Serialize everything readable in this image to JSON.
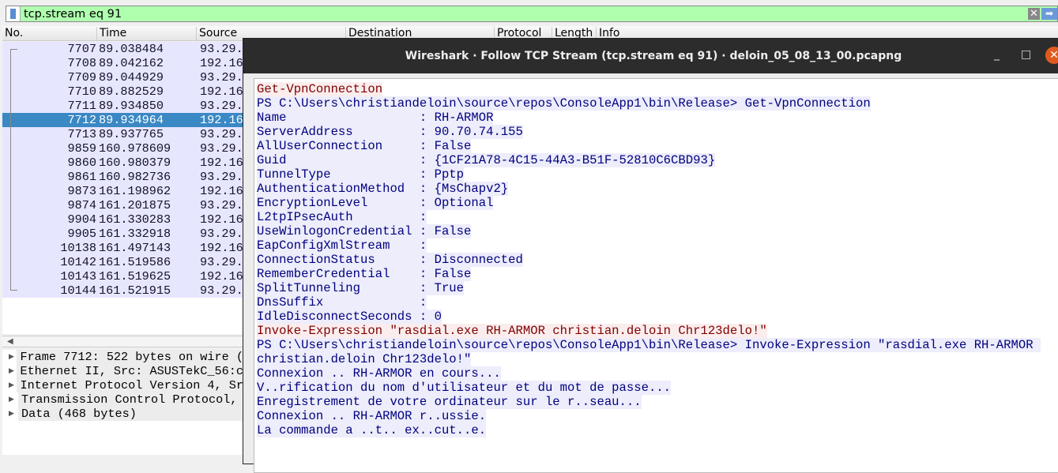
{
  "filter": {
    "value": "tcp.stream eq 91"
  },
  "columns": [
    "No.",
    "Time",
    "Source",
    "Destination",
    "Protocol",
    "Length",
    "Info"
  ],
  "packets": [
    {
      "no": "7707",
      "time": "89.038484",
      "src": "93.29."
    },
    {
      "no": "7708",
      "time": "89.042162",
      "src": "192.16"
    },
    {
      "no": "7709",
      "time": "89.044929",
      "src": "93.29."
    },
    {
      "no": "7710",
      "time": "89.882529",
      "src": "192.16"
    },
    {
      "no": "7711",
      "time": "89.934850",
      "src": "93.29."
    },
    {
      "no": "7712",
      "time": "89.934964",
      "src": "192.16",
      "selected": true
    },
    {
      "no": "7713",
      "time": "89.937765",
      "src": "93.29."
    },
    {
      "no": "9859",
      "time": "160.978609",
      "src": "93.29."
    },
    {
      "no": "9860",
      "time": "160.980379",
      "src": "192.16"
    },
    {
      "no": "9861",
      "time": "160.982736",
      "src": "93.29."
    },
    {
      "no": "9873",
      "time": "161.198962",
      "src": "192.16"
    },
    {
      "no": "9874",
      "time": "161.201875",
      "src": "93.29."
    },
    {
      "no": "9904",
      "time": "161.330283",
      "src": "192.16"
    },
    {
      "no": "9905",
      "time": "161.332918",
      "src": "93.29."
    },
    {
      "no": "10138",
      "time": "161.497143",
      "src": "192.16"
    },
    {
      "no": "10142",
      "time": "161.519586",
      "src": "93.29."
    },
    {
      "no": "10143",
      "time": "161.519625",
      "src": "192.16"
    },
    {
      "no": "10144",
      "time": "161.521915",
      "src": "93.29."
    }
  ],
  "details": [
    "Frame 7712: 522 bytes on wire (",
    "Ethernet II, Src: ASUSTekC_56:c",
    "Internet Protocol Version 4, Sr",
    "Transmission Control Protocol, ",
    "Data (468 bytes)"
  ],
  "dialog": {
    "title": "Wireshark · Follow TCP Stream (tcp.stream eq 91) · deloin_05_08_13_00.pcapng",
    "minimize": "_",
    "maximize": "□",
    "close": "✕",
    "lines": [
      {
        "t": "c",
        "text": "Get-VpnConnection"
      },
      {
        "t": "s",
        "text": "PS C:\\Users\\christiandeloin\\source\\repos\\ConsoleApp1\\bin\\Release> Get-VpnConnection"
      },
      {
        "t": "s",
        "text": "Name                  : RH-ARMOR"
      },
      {
        "t": "s",
        "text": "ServerAddress         : 90.70.74.155"
      },
      {
        "t": "s",
        "text": "AllUserConnection     : False"
      },
      {
        "t": "s",
        "text": "Guid                  : {1CF21A78-4C15-44A3-B51F-52810C6CBD93}"
      },
      {
        "t": "s",
        "text": "TunnelType            : Pptp"
      },
      {
        "t": "s",
        "text": "AuthenticationMethod  : {MsChapv2}"
      },
      {
        "t": "s",
        "text": "EncryptionLevel       : Optional"
      },
      {
        "t": "s",
        "text": "L2tpIPsecAuth         :"
      },
      {
        "t": "s",
        "text": "UseWinlogonCredential : False"
      },
      {
        "t": "s",
        "text": "EapConfigXmlStream    :"
      },
      {
        "t": "s",
        "text": "ConnectionStatus      : Disconnected"
      },
      {
        "t": "s",
        "text": "RememberCredential    : False"
      },
      {
        "t": "s",
        "text": "SplitTunneling        : True"
      },
      {
        "t": "s",
        "text": "DnsSuffix             :"
      },
      {
        "t": "s",
        "text": "IdleDisconnectSeconds : 0"
      },
      {
        "t": "c",
        "text": "Invoke-Expression \"rasdial.exe RH-ARMOR christian.deloin Chr123delo!\""
      },
      {
        "t": "s",
        "text": "PS C:\\Users\\christiandeloin\\source\\repos\\ConsoleApp1\\bin\\Release> Invoke-Expression \"rasdial.exe RH-ARMOR "
      },
      {
        "t": "s",
        "text": "christian.deloin Chr123delo!\""
      },
      {
        "t": "s",
        "text": "Connexion .. RH-ARMOR en cours..."
      },
      {
        "t": "s",
        "text": "V..rification du nom d'utilisateur et du mot de passe..."
      },
      {
        "t": "s",
        "text": "Enregistrement de votre ordinateur sur le r..seau..."
      },
      {
        "t": "s",
        "text": "Connexion .. RH-ARMOR r..ussie."
      },
      {
        "t": "s",
        "text": "La commande a ..t.. ex..cut..e."
      }
    ]
  }
}
